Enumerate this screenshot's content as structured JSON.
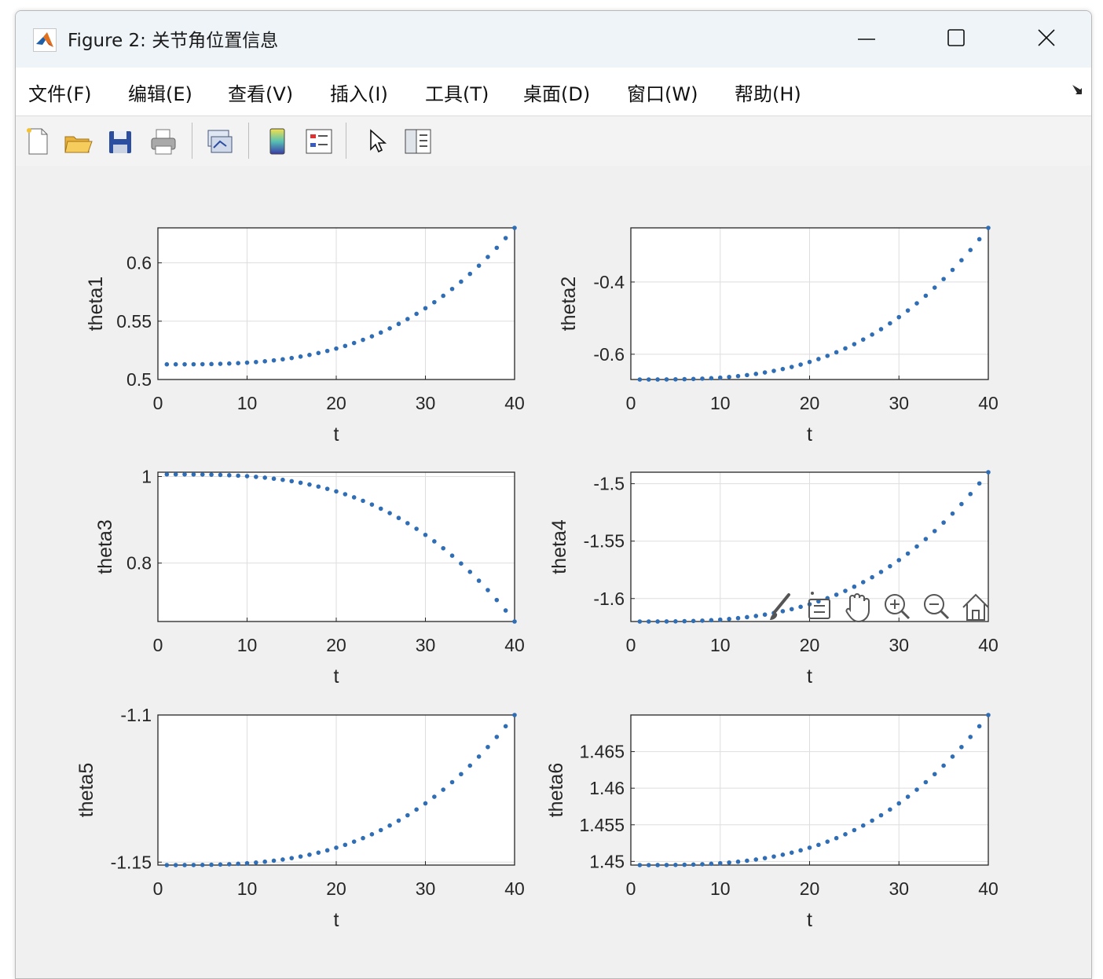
{
  "window": {
    "title": "Figure 2: 关节角位置信息",
    "controls": {
      "minimize_icon": "minimize-icon",
      "maximize_icon": "maximize-icon",
      "close_icon": "close-icon"
    }
  },
  "menubar": {
    "items": [
      {
        "label": "文件(F)"
      },
      {
        "label": "编辑(E)"
      },
      {
        "label": "查看(V)"
      },
      {
        "label": "插入(I)"
      },
      {
        "label": "工具(T)"
      },
      {
        "label": "桌面(D)"
      },
      {
        "label": "窗口(W)"
      },
      {
        "label": "帮助(H)"
      }
    ]
  },
  "toolbar": {
    "buttons": [
      "new-figure-icon",
      "open-file-icon",
      "save-icon",
      "print-icon",
      "link-plot-icon",
      "colorbar-icon",
      "legend-icon",
      "edit-plot-pointer-icon",
      "property-inspector-icon"
    ]
  },
  "axes_toolbar": [
    "brush-icon",
    "data-tips-icon",
    "pan-icon",
    "zoom-in-icon",
    "zoom-out-icon",
    "restore-view-icon"
  ],
  "colors": {
    "marker": "#2f6db5",
    "window_bg": "#f0f0f0",
    "axes_bg": "#ffffff",
    "grid": "#dedede"
  },
  "chart_data": [
    {
      "type": "scatter",
      "ylabel": "theta1",
      "xlabel": "t",
      "xlim": [
        0,
        40
      ],
      "ylim": [
        0.5,
        0.63
      ],
      "xticks": [
        "0",
        "10",
        "20",
        "30",
        "40"
      ],
      "yticks": [
        "0.5",
        "0.55",
        "0.6"
      ],
      "ytick_values": [
        0.5,
        0.55,
        0.6
      ],
      "grid": true,
      "marker_color": "#2f6db5",
      "y_start": 0.513,
      "y_end": 0.63,
      "x_start": 1,
      "x_end": 40,
      "curve": "power",
      "power": 3
    },
    {
      "type": "scatter",
      "ylabel": "theta2",
      "xlabel": "t",
      "xlim": [
        0,
        40
      ],
      "ylim": [
        -0.67,
        -0.25
      ],
      "xticks": [
        "0",
        "10",
        "20",
        "30",
        "40"
      ],
      "yticks": [
        "-0.6",
        "-0.4"
      ],
      "ytick_values": [
        -0.6,
        -0.4
      ],
      "grid": true,
      "marker_color": "#2f6db5",
      "y_start": -0.67,
      "y_end": -0.25,
      "x_start": 1,
      "x_end": 40,
      "curve": "power",
      "power": 3
    },
    {
      "type": "scatter",
      "ylabel": "theta3",
      "xlabel": "t",
      "xlim": [
        0,
        40
      ],
      "ylim": [
        0.665,
        1.01
      ],
      "xticks": [
        "0",
        "10",
        "20",
        "30",
        "40"
      ],
      "yticks": [
        "0.8",
        "1"
      ],
      "ytick_values": [
        0.8,
        1.0
      ],
      "grid": true,
      "marker_color": "#2f6db5",
      "y_start": 1.005,
      "y_end": 0.665,
      "x_start": 1,
      "x_end": 40,
      "curve": "power",
      "power": 3
    },
    {
      "type": "scatter",
      "ylabel": "theta4",
      "xlabel": "t",
      "xlim": [
        0,
        40
      ],
      "ylim": [
        -1.62,
        -1.49
      ],
      "xticks": [
        "0",
        "10",
        "20",
        "30",
        "40"
      ],
      "yticks": [
        "-1.6",
        "-1.55",
        "-1.5"
      ],
      "ytick_values": [
        -1.6,
        -1.55,
        -1.5
      ],
      "grid": true,
      "marker_color": "#2f6db5",
      "y_start": -1.62,
      "y_end": -1.49,
      "x_start": 1,
      "x_end": 40,
      "curve": "power",
      "power": 3
    },
    {
      "type": "scatter",
      "ylabel": "theta5",
      "xlabel": "t",
      "xlim": [
        0,
        40
      ],
      "ylim": [
        -1.151,
        -1.1
      ],
      "xticks": [
        "0",
        "10",
        "20",
        "30",
        "40"
      ],
      "yticks": [
        "-1.15",
        "-1.1"
      ],
      "ytick_values": [
        -1.15,
        -1.1
      ],
      "grid": true,
      "marker_color": "#2f6db5",
      "y_start": -1.151,
      "y_end": -1.1,
      "x_start": 1,
      "x_end": 40,
      "curve": "power",
      "power": 3
    },
    {
      "type": "scatter",
      "ylabel": "theta6",
      "xlabel": "t",
      "xlim": [
        0,
        40
      ],
      "ylim": [
        1.4495,
        1.47
      ],
      "xticks": [
        "0",
        "10",
        "20",
        "30",
        "40"
      ],
      "yticks": [
        "1.45",
        "1.455",
        "1.46",
        "1.465"
      ],
      "ytick_values": [
        1.45,
        1.455,
        1.46,
        1.465
      ],
      "grid": true,
      "marker_color": "#2f6db5",
      "y_start": 1.4495,
      "y_end": 1.47,
      "x_start": 1,
      "x_end": 40,
      "curve": "power",
      "power": 3
    }
  ]
}
